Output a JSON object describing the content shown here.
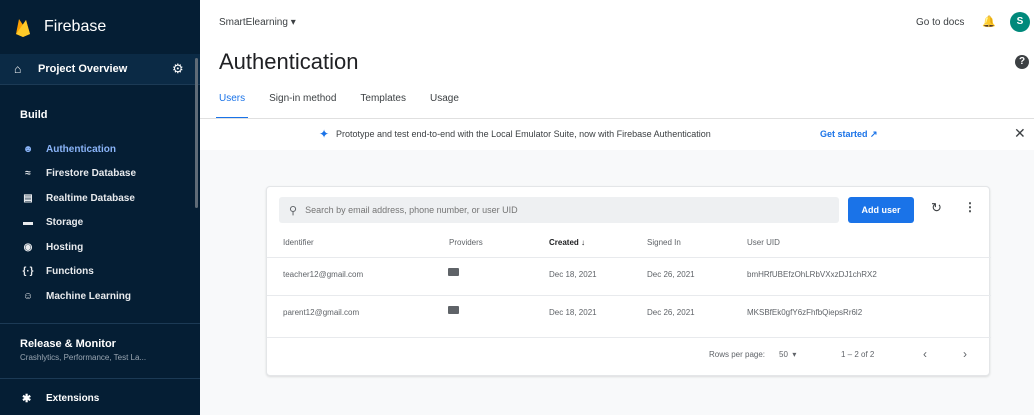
{
  "sidebar": {
    "brand": "Firebase",
    "overview": "Project Overview",
    "build_title": "Build",
    "items": [
      {
        "label": "Authentication",
        "icon": "people-icon"
      },
      {
        "label": "Firestore Database",
        "icon": "firestore-icon"
      },
      {
        "label": "Realtime Database",
        "icon": "database-icon"
      },
      {
        "label": "Storage",
        "icon": "folder-icon"
      },
      {
        "label": "Hosting",
        "icon": "globe-icon"
      },
      {
        "label": "Functions",
        "icon": "functions-icon"
      },
      {
        "label": "Machine Learning",
        "icon": "robot-icon"
      }
    ],
    "release_title": "Release & Monitor",
    "release_sub": "Crashlytics, Performance, Test La...",
    "extensions": "Extensions"
  },
  "header": {
    "project": "SmartElearning",
    "go_to_docs": "Go to docs",
    "avatar_letter": "S",
    "title": "Authentication"
  },
  "tabs": [
    "Users",
    "Sign-in method",
    "Templates",
    "Usage"
  ],
  "banner": {
    "message": "Prototype and test end-to-end with the Local Emulator Suite, now with Firebase Authentication",
    "cta": "Get started"
  },
  "users": {
    "search_placeholder": "Search by email address, phone number, or user UID",
    "add_user": "Add user",
    "columns": [
      "Identifier",
      "Providers",
      "Created",
      "Signed In",
      "User UID"
    ],
    "rows": [
      {
        "identifier": "teacher12@gmail.com",
        "created": "Dec 18, 2021",
        "signed_in": "Dec 26, 2021",
        "uid": "bmHRfUBEfzOhLRbVXxzDJ1chRX2"
      },
      {
        "identifier": "parent12@gmail.com",
        "created": "Dec 18, 2021",
        "signed_in": "Dec 26, 2021",
        "uid": "MKSBfEk0gfY6zFhfbQiepsRr6l2"
      }
    ],
    "rows_per_page_label": "Rows per page:",
    "rows_per_page": "50",
    "range": "1 – 2 of 2"
  },
  "colors": {
    "sidebar_bg": "#051e34",
    "accent": "#1a73e8",
    "active_nav": "#8ab4f8",
    "avatar": "#00897b"
  }
}
